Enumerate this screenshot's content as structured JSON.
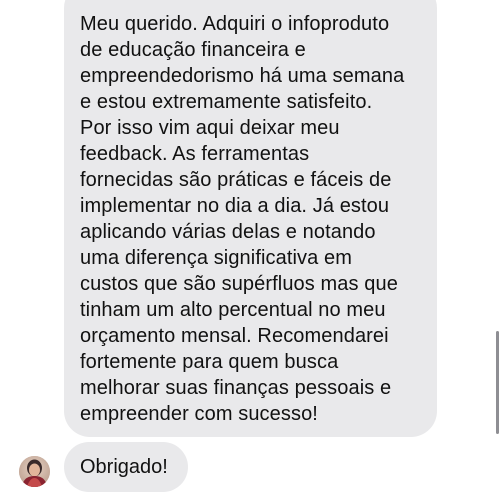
{
  "conversation": {
    "incoming_message": {
      "lines": [
        "Meu querido. Adquiri o infoproduto",
        "de educação financeira e",
        "empreendedorismo há uma semana",
        "e estou extremamente satisfeito.",
        "Por isso vim aqui deixar meu",
        "feedback. As ferramentas",
        "fornecidas são práticas e fáceis de",
        "implementar no dia a dia. Já estou",
        "aplicando várias delas e notando",
        "uma diferença significativa em",
        "custos que são supérfluos mas que",
        "tinham um alto percentual no meu",
        "orçamento mensal. Recomendarei",
        "fortemente para quem busca",
        "melhorar suas finanças pessoais e",
        "empreender com sucesso!"
      ]
    },
    "follow_up_message": {
      "text": "Obrigado!"
    },
    "sender": {
      "avatar_icon": "user-avatar-photo"
    }
  },
  "colors": {
    "bubble_background": "#e9e9eb",
    "text": "#111111",
    "background": "#ffffff",
    "scrollbar": "#8e8e93"
  }
}
